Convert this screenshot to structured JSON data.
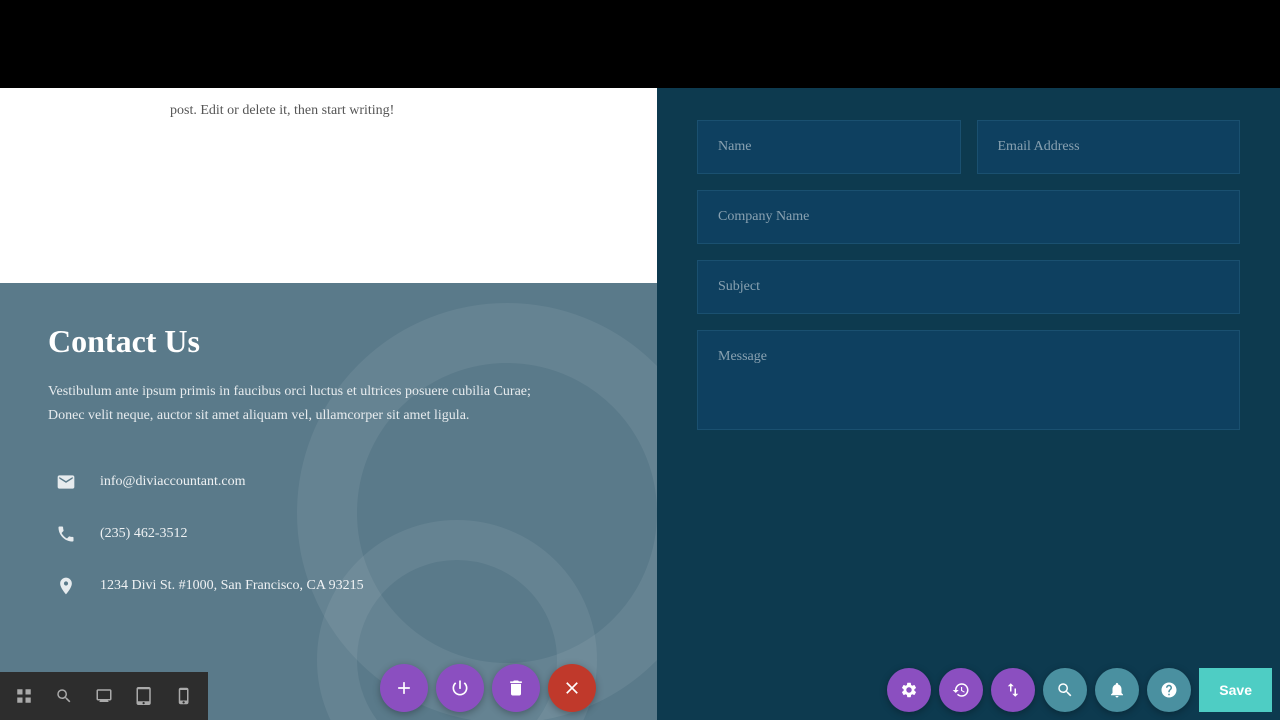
{
  "topBar": {
    "height": 88
  },
  "blogText": "post. Edit or delete it, then start writing!",
  "contact": {
    "title": "Contact Us",
    "description": "Vestibulum ante ipsum primis in faucibus orci luctus et ultrices posuere cubilia Curae; Donec velit neque, auctor sit amet aliquam vel, ullamcorper sit amet ligula.",
    "email": "info@diviaccountant.com",
    "phone": "(235) 462-3512",
    "address": "1234 Divi St. #1000, San Francisco, CA 93215"
  },
  "form": {
    "namePlaceholder": "Name",
    "emailPlaceholder": "Email Address",
    "companyPlaceholder": "Company Name",
    "subjectPlaceholder": "Subject",
    "messagePlaceholder": "Message"
  },
  "toolbar": {
    "saveLabel": "Save",
    "fabLabels": {
      "add": "+",
      "power": "power",
      "trash": "trash",
      "close": "close",
      "gear": "gear",
      "history": "history",
      "sort": "sort",
      "search": "search",
      "settings": "settings",
      "help": "?"
    }
  }
}
